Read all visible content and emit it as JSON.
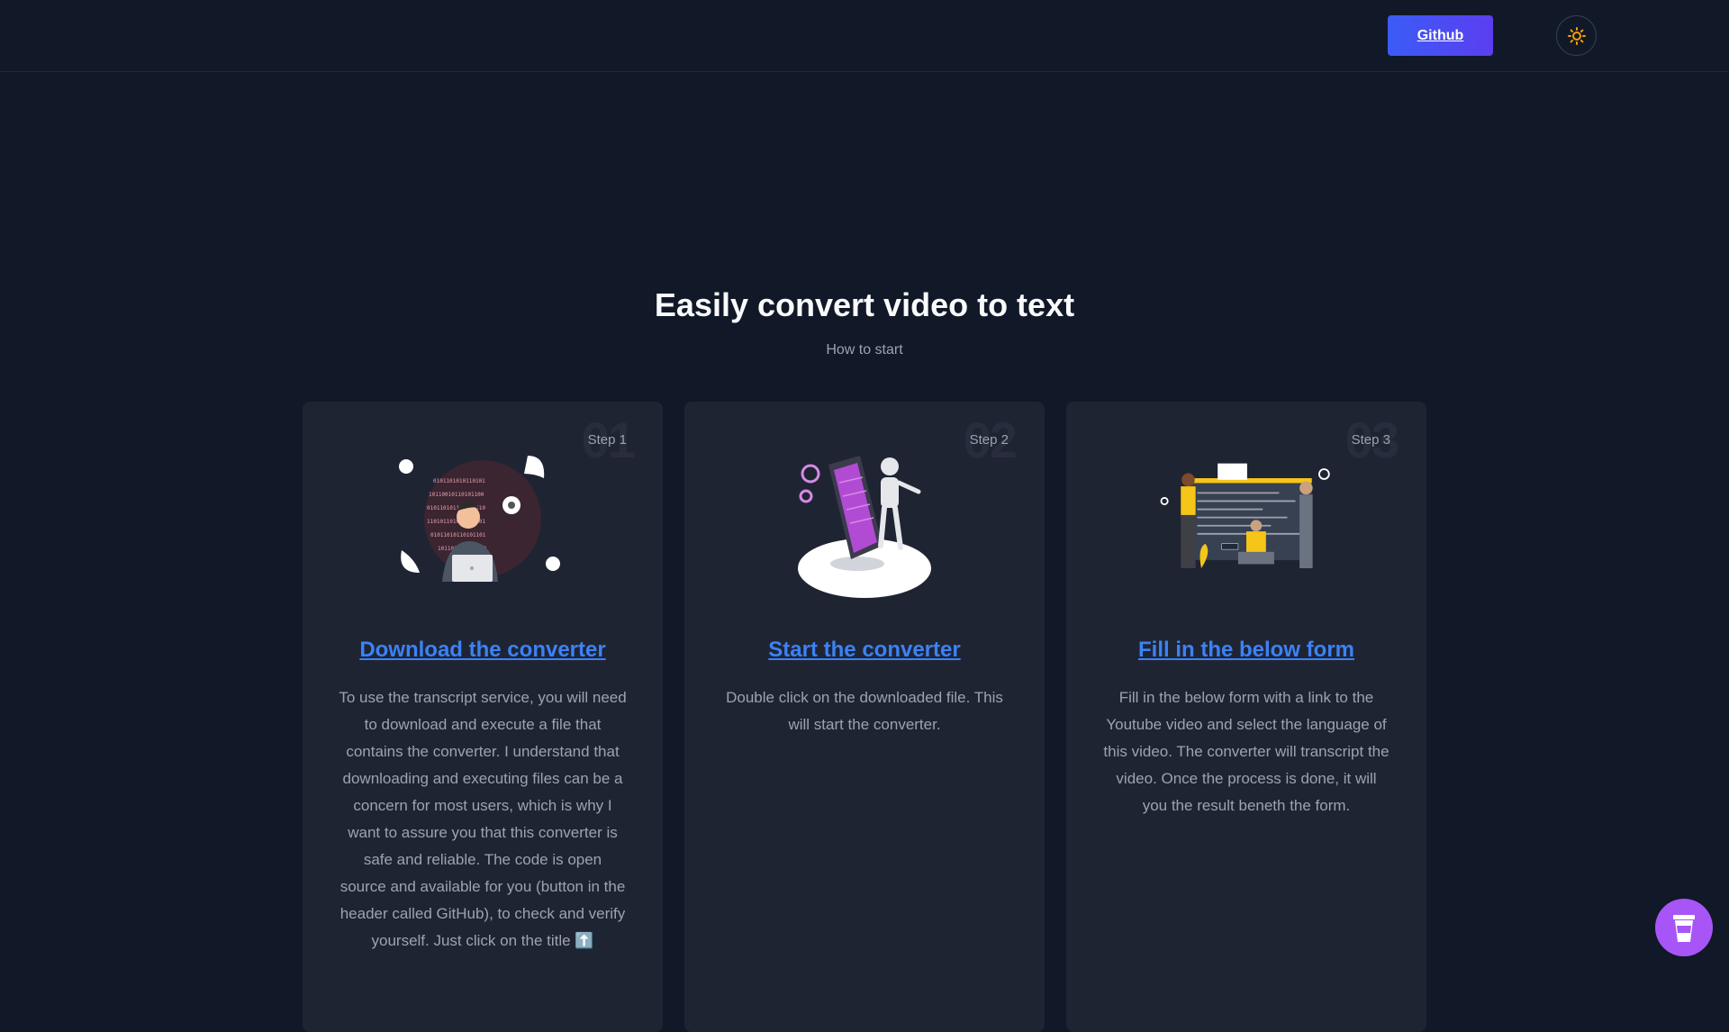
{
  "header": {
    "github_label": "Github",
    "theme_icon": "sun-icon"
  },
  "hero": {
    "title": "Easily convert video to text",
    "subtitle": "How to start"
  },
  "steps": [
    {
      "number": "01",
      "label": "Step 1",
      "title": "Download the converter",
      "text": "To use the transcript service, you will need to download and execute a file that contains the converter. I understand that downloading and executing files can be a concern for most users, which is why I want to assure you that this converter is safe and reliable. The code is open source and available for you (button in the header called GitHub), to check and verify yourself. Just click on the title ⬆️",
      "illustration": "developer-illustration"
    },
    {
      "number": "02",
      "label": "Step 2",
      "title": "Start the converter",
      "text": "Double click on the downloaded file. This will start the converter.",
      "illustration": "robot-phone-illustration"
    },
    {
      "number": "03",
      "label": "Step 3",
      "title": "Fill in the below form",
      "text": "Fill in the below form with a link to the Youtube video and select the language of this video. The converter will transcript the video. Once the process is done, it will you the result beneth the form.",
      "illustration": "team-coding-illustration"
    }
  ],
  "floating": {
    "coffee_icon": "coffee-cup-icon"
  },
  "colors": {
    "background": "#111827",
    "card": "#1f2433",
    "link": "#3b82f6",
    "accent": "#a855f7"
  }
}
